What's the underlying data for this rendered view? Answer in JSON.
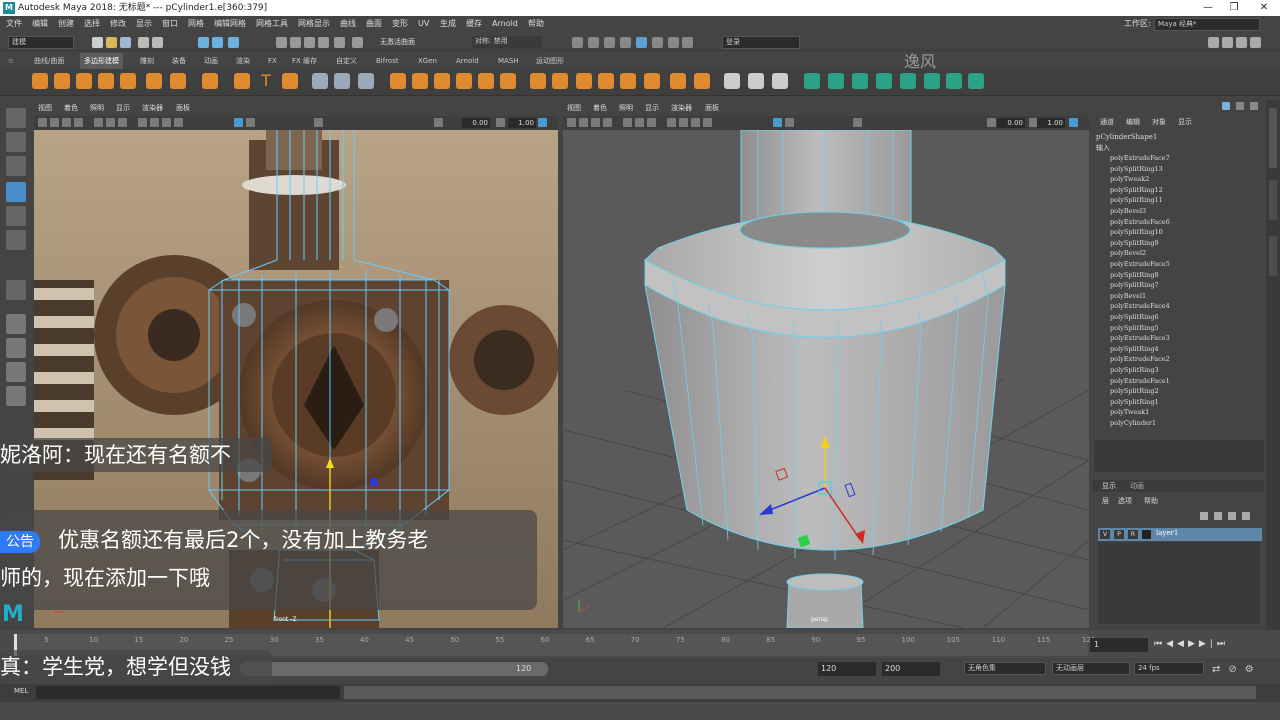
{
  "titlebar": {
    "title": "Autodesk Maya 2018: 无标题*   ---   pCylinder1.e[360:379]",
    "minimize": "—",
    "maximize": "❐",
    "close": "✕"
  },
  "menubar": {
    "items": [
      "文件",
      "编辑",
      "创建",
      "选择",
      "修改",
      "显示",
      "窗口",
      "网格",
      "编辑网格",
      "网格工具",
      "网格显示",
      "曲线",
      "曲面",
      "变形",
      "UV",
      "生成",
      "缓存",
      "Arnold",
      "帮助"
    ],
    "workspace_label": "工作区:",
    "workspace_value": "Maya 经典*"
  },
  "statusline": {
    "mode": "建模",
    "no_live": "无激活曲面",
    "symmetry": "对称: 禁用",
    "login": "登录"
  },
  "shelf": {
    "tabs": [
      "曲线/曲面",
      "多边形建模",
      "雕刻",
      "装备",
      "动画",
      "渲染",
      "FX",
      "FX 缓存",
      "自定义",
      "Bifrost",
      "XGen",
      "Arnold",
      "MASH",
      "运动图形"
    ],
    "active_tab": "多边形建模",
    "watermark": "逸风"
  },
  "viewport_left": {
    "menu": [
      "视图",
      "着色",
      "照明",
      "显示",
      "渲染器",
      "面板"
    ],
    "field1": "0.00",
    "field2": "1.00",
    "camera": "front -Z"
  },
  "viewport_right": {
    "menu": [
      "视图",
      "着色",
      "照明",
      "显示",
      "渲染器",
      "面板"
    ],
    "field1": "0.00",
    "field2": "1.00",
    "camera": "persp"
  },
  "channelbox": {
    "tabs": [
      "通道",
      "编辑",
      "对象",
      "显示"
    ],
    "object": "pCylinderShape1",
    "inputs_label": "输入",
    "history": [
      "polyExtrudeFace7",
      "polySplitRing13",
      "polyTweak2",
      "polySplitRing12",
      "polySplitRing11",
      "polyBevel3",
      "polyExtrudeFace6",
      "polySplitRing10",
      "polySplitRing9",
      "polyBevel2",
      "polyExtrudeFace5",
      "polySplitRing8",
      "polySplitRing7",
      "polyBevel1",
      "polyExtrudeFace4",
      "polySplitRing6",
      "polySplitRing5",
      "polyExtrudeFace3",
      "polySplitRing4",
      "polyExtrudeFace2",
      "polySplitRing3",
      "polyExtrudeFace1",
      "polySplitRing2",
      "polySplitRing1",
      "polyTweak1",
      "polyCylinder1"
    ]
  },
  "layers": {
    "tabs": [
      "显示",
      "动画"
    ],
    "menu": [
      "层",
      "选项",
      "帮助"
    ],
    "layer": {
      "v": "V",
      "p": "P",
      "r": "R",
      "name": "layer1"
    }
  },
  "timeline": {
    "ticks": [
      "5",
      "10",
      "15",
      "20",
      "25",
      "30",
      "35",
      "40",
      "45",
      "50",
      "55",
      "60",
      "65",
      "70",
      "75",
      "80",
      "85",
      "90",
      "95",
      "100",
      "105",
      "110",
      "115",
      "120"
    ],
    "current_frame": "1"
  },
  "range": {
    "start": "1",
    "end_inner": "120",
    "end": "120",
    "end_outer": "200",
    "char_set": "无角色集",
    "anim_layer": "无动画层",
    "fps": "24 fps"
  },
  "mel": {
    "label": "MEL"
  },
  "chat": {
    "line1": "妮洛阿：现在还有名额不",
    "announce_badge": "公告",
    "announce_line1": "优惠名额还有最后2个，没有加上教务老",
    "announce_line2": "师的，现在添加一下哦",
    "line3": "真：学生党，想学但没钱"
  }
}
